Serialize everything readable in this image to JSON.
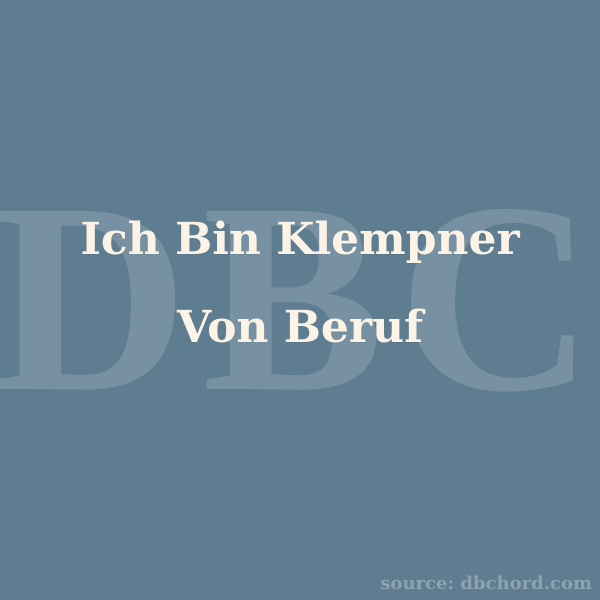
{
  "watermark": {
    "text": "DBC"
  },
  "title": {
    "text": "Ich Bin Klempner Von Beruf"
  },
  "source": {
    "text": "source: dbchord.com"
  },
  "colors": {
    "background": "#5f7d90",
    "watermark": "#7a93a3",
    "title": "#fbf3e6",
    "source": "#8ea3b1"
  }
}
